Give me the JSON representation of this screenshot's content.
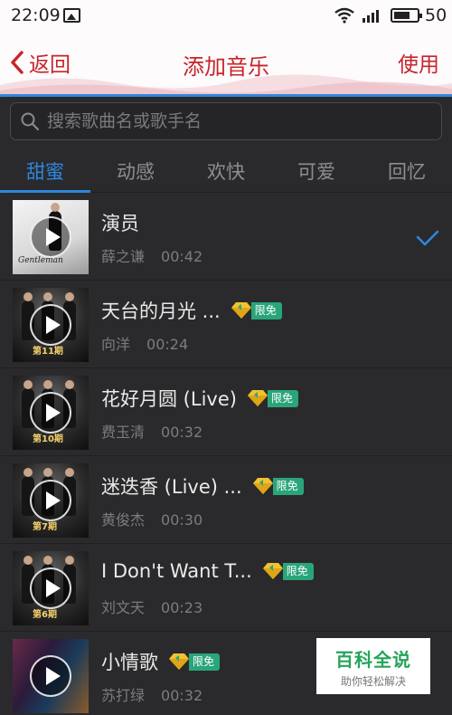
{
  "status_bar": {
    "time": "22:09",
    "battery": "50",
    "icons": [
      "image-icon",
      "wifi-icon",
      "signal-icon",
      "battery-icon"
    ]
  },
  "header": {
    "back_label": "返回",
    "title": "添加音乐",
    "use_label": "使用",
    "accent_color": "#c8232c"
  },
  "search": {
    "placeholder": "搜索歌曲名或歌手名"
  },
  "tabs": [
    {
      "label": "甜蜜",
      "active": true
    },
    {
      "label": "动感",
      "active": false
    },
    {
      "label": "欢快",
      "active": false
    },
    {
      "label": "可爱",
      "active": false
    },
    {
      "label": "回忆",
      "active": false
    }
  ],
  "songs": [
    {
      "title": "演员",
      "artist": "薛之谦",
      "duration": "00:42",
      "selected": true,
      "free": false
    },
    {
      "title": "天台的月光 ...",
      "artist": "向洋",
      "duration": "00:24",
      "selected": false,
      "free": true,
      "cover_tag": "第11期"
    },
    {
      "title": "花好月圆 (Live)",
      "artist": "费玉清",
      "duration": "00:32",
      "selected": false,
      "free": true,
      "cover_tag": "第10期"
    },
    {
      "title": "迷迭香 (Live) ...",
      "artist": "黄俊杰",
      "duration": "00:30",
      "selected": false,
      "free": true,
      "cover_tag": "第7期"
    },
    {
      "title": "I Don't Want T...",
      "artist": "刘文天",
      "duration": "00:23",
      "selected": false,
      "free": true,
      "cover_tag": "第6期"
    },
    {
      "title": "小情歌",
      "artist": "苏打绿",
      "duration": "00:32",
      "selected": false,
      "free": true
    }
  ],
  "free_badge_label": "限免",
  "watermark": {
    "main": "百科全说",
    "sub": "助你轻松解决"
  },
  "colors": {
    "tab_active": "#2e86de",
    "background": "#2a2a2c",
    "free_badge": "#2aa57a",
    "check": "#2e86de"
  }
}
